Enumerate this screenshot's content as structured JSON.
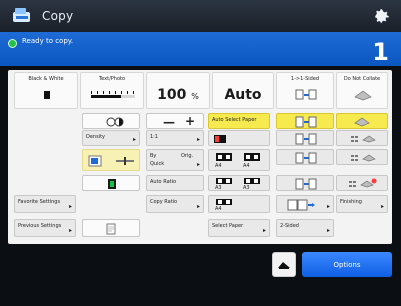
{
  "header": {
    "title": "Copy"
  },
  "status": {
    "message": "Ready to copy.",
    "copies": "1"
  },
  "top": {
    "color_mode_label": "Black & White",
    "original_type_label": "Text/Photo",
    "copy_ratio_value": "100",
    "copy_ratio_unit": "%",
    "paper_select_value": "Auto",
    "duplex_label": "1->1-Sided",
    "collate_label": "Do Not Collate"
  },
  "grid": {
    "density_label": "Density",
    "ratio_label": "1:1",
    "auto_select_paper_label": "Auto Select Paper",
    "orig_paper_label": "Orig.",
    "auto_ratio_label": "Auto Ratio",
    "copy_ratio_label": "Copy Ratio",
    "favorite_settings_label": "Favorite Settings",
    "previous_settings_label": "Previous Settings",
    "select_paper_label": "Select Paper",
    "two_sided_label": "2-Sided",
    "finishing_label": "Finishing",
    "paper_size_a4": "A4",
    "paper_size_a3": "A3",
    "by_label": "By",
    "quick_label": "Quick"
  },
  "footer": {
    "options_label": "Options"
  }
}
